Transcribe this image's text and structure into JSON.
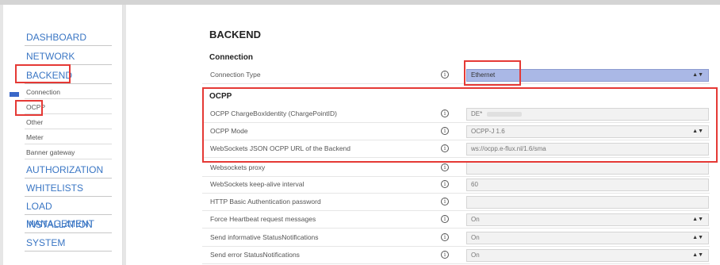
{
  "sidebar": {
    "items": [
      {
        "label": "DASHBOARD",
        "type": "top"
      },
      {
        "label": "NETWORK",
        "type": "top"
      },
      {
        "label": "BACKEND",
        "type": "top"
      },
      {
        "label": "Connection",
        "type": "sub"
      },
      {
        "label": "OCPP",
        "type": "sub"
      },
      {
        "label": "Other",
        "type": "sub"
      },
      {
        "label": "Meter",
        "type": "sub"
      },
      {
        "label": "Banner gateway",
        "type": "sub"
      },
      {
        "label": "AUTHORIZATION",
        "type": "top"
      },
      {
        "label": "WHITELISTS",
        "type": "top"
      },
      {
        "label": "LOAD MANAGEMENT",
        "type": "top"
      },
      {
        "label": "INSTALLATION",
        "type": "top"
      },
      {
        "label": "SYSTEM",
        "type": "top"
      }
    ]
  },
  "main": {
    "page_title": "BACKEND",
    "connection": {
      "title": "Connection",
      "rows": [
        {
          "label": "Connection Type",
          "value": "Ethernet"
        }
      ]
    },
    "ocpp": {
      "title": "OCPP",
      "rows": [
        {
          "label": "OCPP ChargeBoxIdentity (ChargePointID)",
          "value": "DE*"
        },
        {
          "label": "OCPP Mode",
          "value": "OCPP-J 1.6"
        },
        {
          "label": "WebSockets JSON OCPP URL of the Backend",
          "value": "ws://ocpp.e-flux.nl/1.6/sma"
        },
        {
          "label": "Websockets proxy",
          "value": ""
        },
        {
          "label": "WebSockets keep-alive interval",
          "value": "60"
        },
        {
          "label": "HTTP Basic Authentication password",
          "value": ""
        },
        {
          "label": "Force Heartbeat request messages",
          "value": "On"
        },
        {
          "label": "Send informative StatusNotifications",
          "value": "On"
        },
        {
          "label": "Send error StatusNotifications",
          "value": "On"
        }
      ]
    }
  },
  "icons": {
    "info": "info-icon",
    "caret": "updown-caret-icon"
  },
  "colors": {
    "accent": "#3a76c4",
    "highlight": "#aab8e6",
    "annotation": "#e53935"
  }
}
